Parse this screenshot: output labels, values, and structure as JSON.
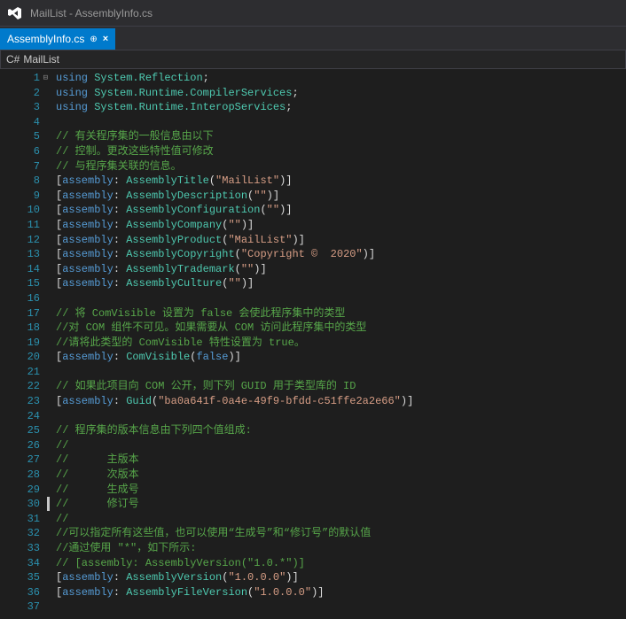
{
  "title": "MailList - AssemblyInfo.cs",
  "tab": {
    "name": "AssemblyInfo.cs",
    "pinned": true
  },
  "namespace": "MailList",
  "cursor_line": 30,
  "code": {
    "lines": [
      {
        "n": 1,
        "tokens": [
          [
            "kw",
            "using"
          ],
          [
            "pnc",
            " "
          ],
          [
            "type",
            "System.Reflection"
          ],
          [
            "pnc",
            ";"
          ]
        ]
      },
      {
        "n": 2,
        "tokens": [
          [
            "kw",
            "using"
          ],
          [
            "pnc",
            " "
          ],
          [
            "type",
            "System.Runtime.CompilerServices"
          ],
          [
            "pnc",
            ";"
          ]
        ]
      },
      {
        "n": 3,
        "tokens": [
          [
            "kw",
            "using"
          ],
          [
            "pnc",
            " "
          ],
          [
            "type",
            "System.Runtime.InteropServices"
          ],
          [
            "pnc",
            ";"
          ]
        ]
      },
      {
        "n": 4,
        "tokens": []
      },
      {
        "n": 5,
        "tokens": [
          [
            "cmt",
            "// 有关程序集的一般信息由以下"
          ]
        ]
      },
      {
        "n": 6,
        "tokens": [
          [
            "cmt",
            "// 控制。更改这些特性值可修改"
          ]
        ]
      },
      {
        "n": 7,
        "tokens": [
          [
            "cmt",
            "// 与程序集关联的信息。"
          ]
        ]
      },
      {
        "n": 8,
        "tokens": [
          [
            "pnc",
            "["
          ],
          [
            "kw",
            "assembly"
          ],
          [
            "pnc",
            ": "
          ],
          [
            "type",
            "AssemblyTitle"
          ],
          [
            "pnc",
            "("
          ],
          [
            "str",
            "\"MailList\""
          ],
          [
            "pnc",
            ")]"
          ]
        ]
      },
      {
        "n": 9,
        "tokens": [
          [
            "pnc",
            "["
          ],
          [
            "kw",
            "assembly"
          ],
          [
            "pnc",
            ": "
          ],
          [
            "type",
            "AssemblyDescription"
          ],
          [
            "pnc",
            "("
          ],
          [
            "str",
            "\"\""
          ],
          [
            "pnc",
            ")]"
          ]
        ]
      },
      {
        "n": 10,
        "tokens": [
          [
            "pnc",
            "["
          ],
          [
            "kw",
            "assembly"
          ],
          [
            "pnc",
            ": "
          ],
          [
            "type",
            "AssemblyConfiguration"
          ],
          [
            "pnc",
            "("
          ],
          [
            "str",
            "\"\""
          ],
          [
            "pnc",
            ")]"
          ]
        ]
      },
      {
        "n": 11,
        "tokens": [
          [
            "pnc",
            "["
          ],
          [
            "kw",
            "assembly"
          ],
          [
            "pnc",
            ": "
          ],
          [
            "type",
            "AssemblyCompany"
          ],
          [
            "pnc",
            "("
          ],
          [
            "str",
            "\"\""
          ],
          [
            "pnc",
            ")]"
          ]
        ]
      },
      {
        "n": 12,
        "tokens": [
          [
            "pnc",
            "["
          ],
          [
            "kw",
            "assembly"
          ],
          [
            "pnc",
            ": "
          ],
          [
            "type",
            "AssemblyProduct"
          ],
          [
            "pnc",
            "("
          ],
          [
            "str",
            "\"MailList\""
          ],
          [
            "pnc",
            ")]"
          ]
        ]
      },
      {
        "n": 13,
        "tokens": [
          [
            "pnc",
            "["
          ],
          [
            "kw",
            "assembly"
          ],
          [
            "pnc",
            ": "
          ],
          [
            "type",
            "AssemblyCopyright"
          ],
          [
            "pnc",
            "("
          ],
          [
            "str",
            "\"Copyright ©  2020\""
          ],
          [
            "pnc",
            ")]"
          ]
        ]
      },
      {
        "n": 14,
        "tokens": [
          [
            "pnc",
            "["
          ],
          [
            "kw",
            "assembly"
          ],
          [
            "pnc",
            ": "
          ],
          [
            "type",
            "AssemblyTrademark"
          ],
          [
            "pnc",
            "("
          ],
          [
            "str",
            "\"\""
          ],
          [
            "pnc",
            ")]"
          ]
        ]
      },
      {
        "n": 15,
        "tokens": [
          [
            "pnc",
            "["
          ],
          [
            "kw",
            "assembly"
          ],
          [
            "pnc",
            ": "
          ],
          [
            "type",
            "AssemblyCulture"
          ],
          [
            "pnc",
            "("
          ],
          [
            "str",
            "\"\""
          ],
          [
            "pnc",
            ")]"
          ]
        ]
      },
      {
        "n": 16,
        "tokens": []
      },
      {
        "n": 17,
        "tokens": [
          [
            "cmt",
            "// 将 ComVisible 设置为 false 会使此程序集中的类型"
          ]
        ]
      },
      {
        "n": 18,
        "tokens": [
          [
            "cmt",
            "//对 COM 组件不可见。如果需要从 COM 访问此程序集中的类型"
          ]
        ]
      },
      {
        "n": 19,
        "tokens": [
          [
            "cmt",
            "//请将此类型的 ComVisible 特性设置为 true。"
          ]
        ]
      },
      {
        "n": 20,
        "tokens": [
          [
            "pnc",
            "["
          ],
          [
            "kw",
            "assembly"
          ],
          [
            "pnc",
            ": "
          ],
          [
            "type",
            "ComVisible"
          ],
          [
            "pnc",
            "("
          ],
          [
            "kw",
            "false"
          ],
          [
            "pnc",
            ")]"
          ]
        ]
      },
      {
        "n": 21,
        "tokens": []
      },
      {
        "n": 22,
        "tokens": [
          [
            "cmt",
            "// 如果此项目向 COM 公开，则下列 GUID 用于类型库的 ID"
          ]
        ]
      },
      {
        "n": 23,
        "tokens": [
          [
            "pnc",
            "["
          ],
          [
            "kw",
            "assembly"
          ],
          [
            "pnc",
            ": "
          ],
          [
            "type",
            "Guid"
          ],
          [
            "pnc",
            "("
          ],
          [
            "str",
            "\"ba0a641f-0a4e-49f9-bfdd-c51ffe2a2e66\""
          ],
          [
            "pnc",
            ")]"
          ]
        ]
      },
      {
        "n": 24,
        "tokens": []
      },
      {
        "n": 25,
        "tokens": [
          [
            "cmt",
            "// 程序集的版本信息由下列四个值组成: "
          ]
        ]
      },
      {
        "n": 26,
        "tokens": [
          [
            "cmt",
            "//"
          ]
        ]
      },
      {
        "n": 27,
        "tokens": [
          [
            "cmt",
            "//      主版本"
          ]
        ]
      },
      {
        "n": 28,
        "tokens": [
          [
            "cmt",
            "//      次版本"
          ]
        ]
      },
      {
        "n": 29,
        "tokens": [
          [
            "cmt",
            "//      生成号"
          ]
        ]
      },
      {
        "n": 30,
        "tokens": [
          [
            "cmt",
            "//      修订号"
          ]
        ]
      },
      {
        "n": 31,
        "tokens": [
          [
            "cmt",
            "//"
          ]
        ]
      },
      {
        "n": 32,
        "tokens": [
          [
            "cmt",
            "//可以指定所有这些值，也可以使用“生成号”和“修订号”的默认值"
          ]
        ]
      },
      {
        "n": 33,
        "tokens": [
          [
            "cmt",
            "//通过使用 \"*\"，如下所示:"
          ]
        ]
      },
      {
        "n": 34,
        "tokens": [
          [
            "cmt",
            "// [assembly: AssemblyVersion(\"1.0.*\")]"
          ]
        ]
      },
      {
        "n": 35,
        "tokens": [
          [
            "pnc",
            "["
          ],
          [
            "kw",
            "assembly"
          ],
          [
            "pnc",
            ": "
          ],
          [
            "type",
            "AssemblyVersion"
          ],
          [
            "pnc",
            "("
          ],
          [
            "str",
            "\"1.0.0.0\""
          ],
          [
            "pnc",
            ")]"
          ]
        ]
      },
      {
        "n": 36,
        "tokens": [
          [
            "pnc",
            "["
          ],
          [
            "kw",
            "assembly"
          ],
          [
            "pnc",
            ": "
          ],
          [
            "type",
            "AssemblyFileVersion"
          ],
          [
            "pnc",
            "("
          ],
          [
            "str",
            "\"1.0.0.0\""
          ],
          [
            "pnc",
            ")]"
          ]
        ]
      },
      {
        "n": 37,
        "tokens": []
      }
    ]
  }
}
